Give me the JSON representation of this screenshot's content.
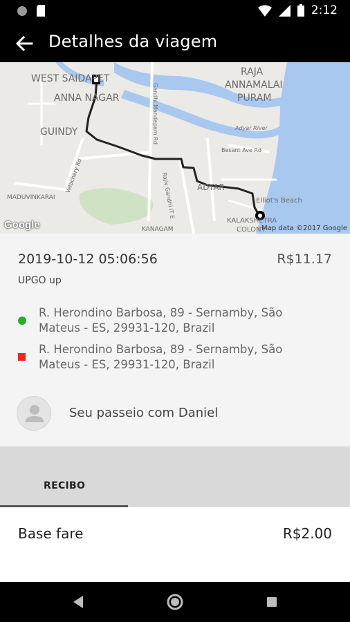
{
  "status_bar": {
    "time": "2:12",
    "icons": [
      "circle-notification-icon",
      "sd-card-icon",
      "wifi-icon",
      "signal-icon",
      "battery-icon"
    ]
  },
  "app_bar": {
    "title": "Detalhes da viagem",
    "back_icon": "arrow-left-icon"
  },
  "map": {
    "labels": [
      "WEST SAIDAPET",
      "ANNA NAGAR",
      "RAJA",
      "ANNAMALAI",
      "PURAM",
      "GUINDY",
      "ADYAR",
      "Elliot's Beach",
      "KALAKSHETRA",
      "COLONY",
      "MADUVINKARAI",
      "KANAGAM",
      "Adyar River",
      "Besant Ave Rd",
      "Rajiv Gandhi IT E",
      "Gandhi Mandapam Rd",
      "Velachery Rd"
    ],
    "logo": "Google",
    "credit": "Map data ©2017 Google"
  },
  "trip": {
    "datetime": "2019-10-12 05:06:56",
    "fare": "R$11.17",
    "product": "UPGO up",
    "pickup_line1": "R. Herondino Barbosa, 89 - Sernamby, São",
    "pickup_line2": "Mateus - ES, 29931-120, Brazil",
    "dropoff_line1": "R. Herondino Barbosa, 89 - Sernamby, São",
    "dropoff_line2": "Mateus - ES, 29931-120, Brazil",
    "driver_text": "Seu passeio com Daniel"
  },
  "tabs": {
    "receipt_label": "RECIBO"
  },
  "receipt": {
    "rows": [
      {
        "label": "Base fare",
        "value": "R$2.00"
      }
    ]
  },
  "colors": {
    "pickup": "#27ae2a",
    "dropoff": "#e52b20",
    "water": "#a8c8f0",
    "route": "#222222"
  },
  "nav_bar": {
    "icons": [
      "back-triangle-icon",
      "home-circle-icon",
      "recents-square-icon"
    ]
  }
}
